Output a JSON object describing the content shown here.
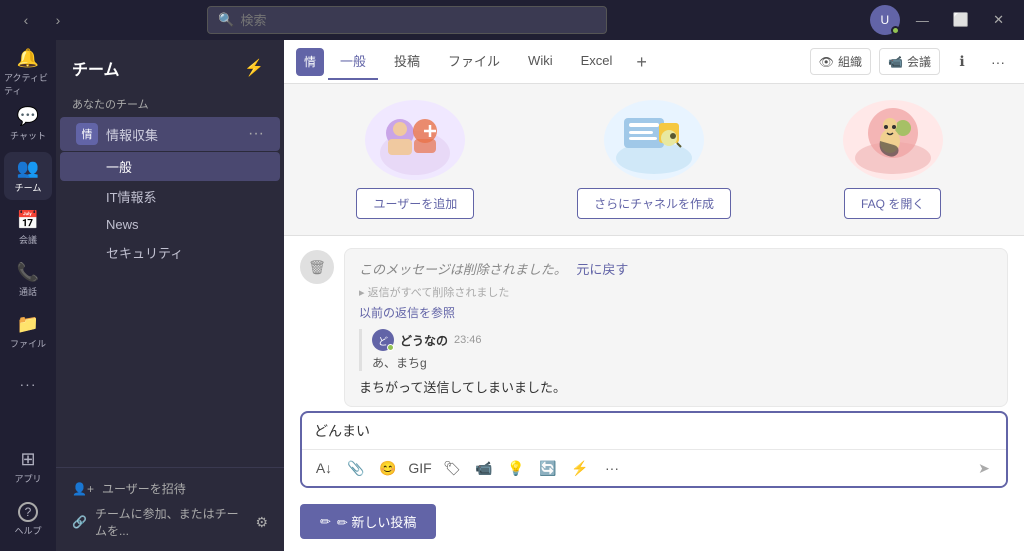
{
  "titlebar": {
    "search_placeholder": "検索",
    "avatar_initials": "U"
  },
  "sidebar": {
    "items": [
      {
        "id": "activity",
        "label": "アクティビティ",
        "icon": "🔔"
      },
      {
        "id": "chat",
        "label": "チャット",
        "icon": "💬"
      },
      {
        "id": "teams",
        "label": "チーム",
        "icon": "👥"
      },
      {
        "id": "calendar",
        "label": "会議",
        "icon": "📅"
      },
      {
        "id": "calls",
        "label": "通話",
        "icon": "📞"
      },
      {
        "id": "files",
        "label": "ファイル",
        "icon": "📁"
      },
      {
        "id": "more",
        "label": "...",
        "icon": "···"
      }
    ],
    "bottom": [
      {
        "id": "apps",
        "label": "アプリ",
        "icon": "⊞"
      },
      {
        "id": "help",
        "label": "ヘルプ",
        "icon": "?"
      }
    ]
  },
  "team_panel": {
    "title": "チーム",
    "your_teams_label": "あなたのチーム",
    "team": {
      "name": "情報収集",
      "badge": "情",
      "channels": [
        {
          "name": "一般",
          "active": true
        },
        {
          "name": "IT情報系"
        },
        {
          "name": "News"
        },
        {
          "name": "セキュリティ"
        }
      ]
    },
    "bottom_links": [
      {
        "label": "ユーザーを招待",
        "icon": "👤"
      },
      {
        "label": "チームに参加、またはチームを...",
        "icon": "🔗"
      }
    ]
  },
  "channel": {
    "tabs": [
      {
        "label": "一般",
        "active": true
      },
      {
        "label": "投稿"
      },
      {
        "label": "ファイル"
      },
      {
        "label": "Wiki"
      },
      {
        "label": "Excel"
      }
    ],
    "right_buttons": [
      {
        "label": "組織",
        "icon": "👁"
      },
      {
        "label": "会議",
        "icon": "📹"
      }
    ]
  },
  "welcome": {
    "cards": [
      {
        "label": "ユーザーを追加"
      },
      {
        "label": "さらにチャネルを作成"
      },
      {
        "label": "FAQ を開く"
      }
    ]
  },
  "chat": {
    "deleted_msg": "このメッセージは削除されました。",
    "undo_link": "元に戻す",
    "deleted_note": "返信がすべて削除されました",
    "prev_replies_link": "以前の返信を参照",
    "reply": {
      "user": "どうなの",
      "time": "23:46",
      "short_text": "あ、まちg",
      "full_text": "まちがって送信してしまいました。"
    },
    "compose_value": "どんまい",
    "compose_tools": [
      "A",
      "📎",
      "😊",
      "⊞",
      "⊟",
      "📹",
      "💡",
      "🔄",
      "⚡",
      "···"
    ]
  },
  "new_post": {
    "label": "✏ 新しい投稿"
  }
}
